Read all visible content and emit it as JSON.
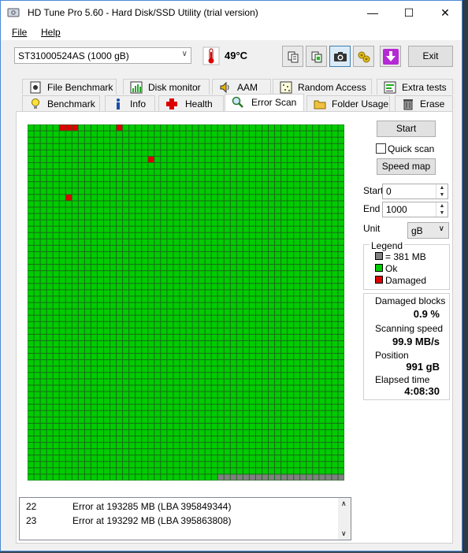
{
  "window": {
    "title": "HD Tune Pro 5.60 - Hard Disk/SSD Utility (trial version)",
    "controls": {
      "minimize": "—",
      "maximize": "☐",
      "close": "✕"
    }
  },
  "menu": {
    "file": "File",
    "help": "Help"
  },
  "toolbar": {
    "drive": "ST31000524AS (1000 gB)",
    "temperature": "49°C",
    "exit_label": "Exit",
    "icons": [
      "copy-info-icon",
      "copy-screenshot-icon",
      "camera-icon",
      "options-icon",
      "download-icon"
    ]
  },
  "tabs": {
    "row1": [
      {
        "label": "File Benchmark",
        "icon": "file-benchmark-icon"
      },
      {
        "label": "Disk monitor",
        "icon": "disk-monitor-icon"
      },
      {
        "label": "AAM",
        "icon": "speaker-icon"
      },
      {
        "label": "Random Access",
        "icon": "random-access-icon"
      },
      {
        "label": "Extra tests",
        "icon": "extra-tests-icon"
      }
    ],
    "row2": [
      {
        "label": "Benchmark",
        "icon": "lightbulb-icon"
      },
      {
        "label": "Info",
        "icon": "info-icon"
      },
      {
        "label": "Health",
        "icon": "health-cross-icon"
      },
      {
        "label": "Error Scan",
        "icon": "magnifier-icon"
      },
      {
        "label": "Folder Usage",
        "icon": "folder-icon"
      },
      {
        "label": "Erase",
        "icon": "trash-icon"
      }
    ],
    "selected": "Error Scan"
  },
  "scan": {
    "start_button": "Start",
    "quick_scan": "Quick scan",
    "quick_scan_checked": false,
    "speed_map_button": "Speed map",
    "start_label": "Start",
    "start_value": "0",
    "end_label": "End",
    "end_value": "1000",
    "unit_label": "Unit",
    "unit_value": "gB"
  },
  "legend": {
    "title": "Legend",
    "block_size": "= 381 MB",
    "ok": "Ok",
    "damaged": "Damaged",
    "colors": {
      "unscanned": "#808080",
      "ok": "#00cc00",
      "damaged": "#dd0000"
    }
  },
  "stats": {
    "damaged_blocks_label": "Damaged blocks",
    "damaged_blocks_value": "0.9 %",
    "scanning_speed_label": "Scanning speed",
    "scanning_speed_value": "99.9 MB/s",
    "position_label": "Position",
    "position_value": "991 gB",
    "elapsed_label": "Elapsed time",
    "elapsed_value": "4:08:30"
  },
  "block_map": {
    "columns": 50,
    "rows": 56,
    "damaged_cells": [
      [
        0,
        5
      ],
      [
        0,
        6
      ],
      [
        0,
        7
      ],
      [
        0,
        14
      ],
      [
        5,
        19
      ],
      [
        11,
        6
      ]
    ],
    "unscanned_start": {
      "row": 55,
      "col": 30
    }
  },
  "log": [
    {
      "n": "22",
      "text": "Error at 193285 MB (LBA 395849344)"
    },
    {
      "n": "23",
      "text": "Error at 193292 MB (LBA 395863808)"
    }
  ]
}
